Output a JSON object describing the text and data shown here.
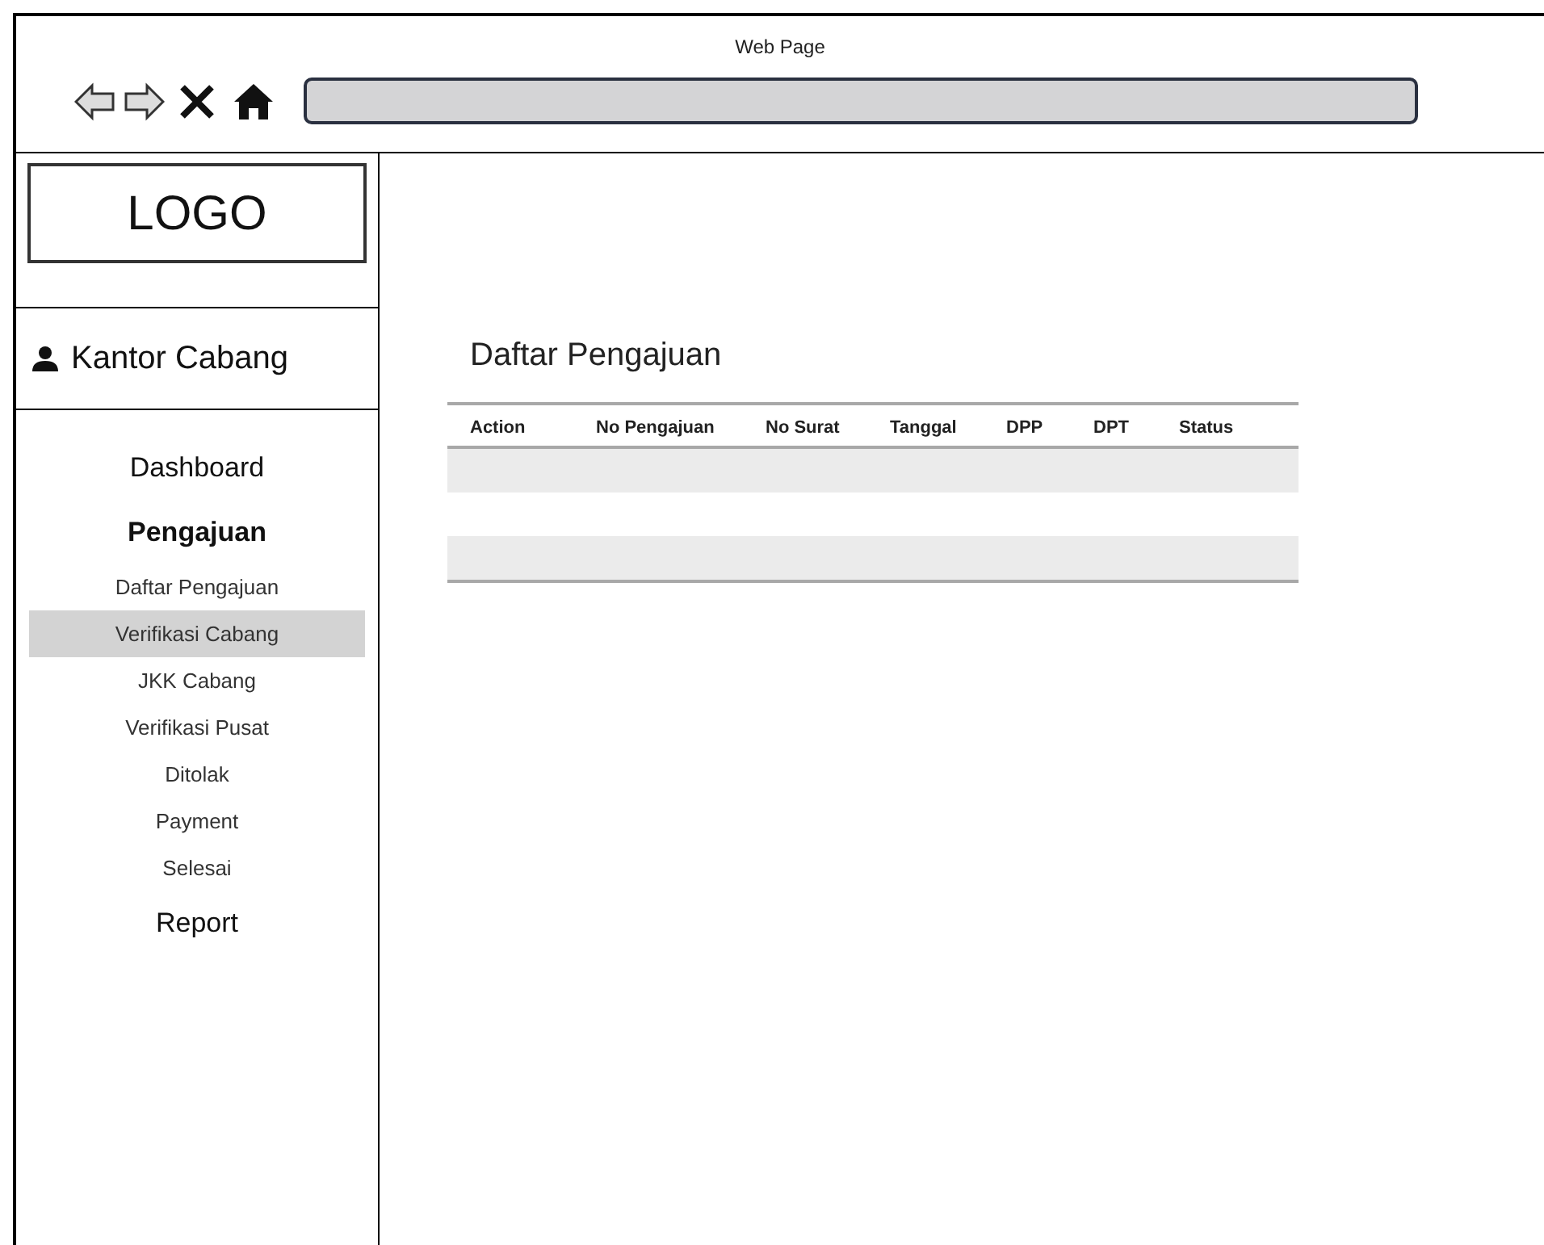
{
  "window": {
    "title": "Web Page"
  },
  "logo": "LOGO",
  "user": {
    "name": "Kantor Cabang"
  },
  "sidebar": {
    "items": [
      {
        "label": "Dashboard",
        "kind": "top",
        "selected": false
      },
      {
        "label": "Pengajuan",
        "kind": "group",
        "expanded": true,
        "children": [
          {
            "label": "Daftar Pengajuan",
            "selected": false
          },
          {
            "label": "Verifikasi Cabang",
            "selected": true
          },
          {
            "label": "JKK Cabang",
            "selected": false
          },
          {
            "label": "Verifikasi Pusat",
            "selected": false
          },
          {
            "label": "Ditolak",
            "selected": false
          },
          {
            "label": "Payment",
            "selected": false
          },
          {
            "label": "Selesai",
            "selected": false
          }
        ]
      },
      {
        "label": "Report",
        "kind": "top",
        "selected": false
      }
    ]
  },
  "page": {
    "title": "Daftar Pengajuan"
  },
  "table": {
    "columns": [
      "Action",
      "No Pengajuan",
      "No Surat",
      "Tanggal",
      "DPP",
      "DPT",
      "Status"
    ]
  }
}
